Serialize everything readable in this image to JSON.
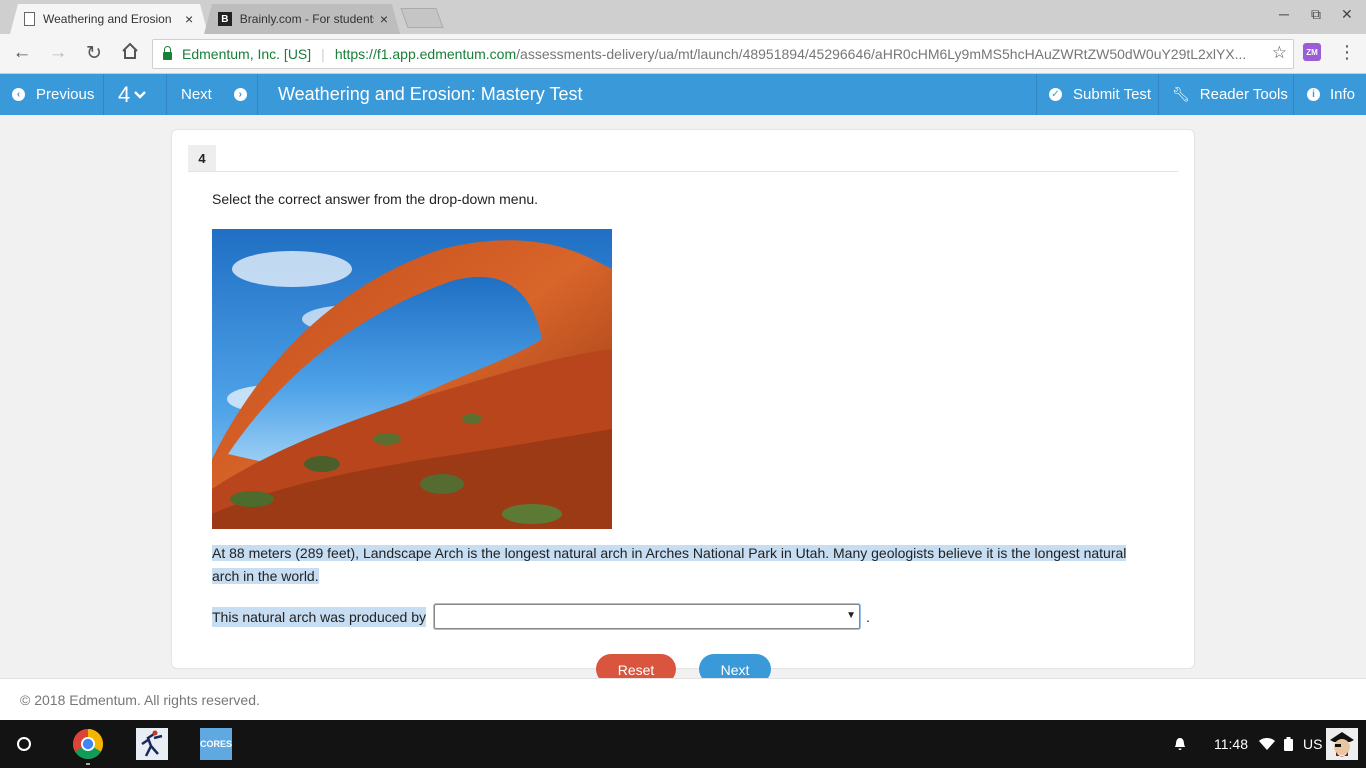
{
  "browser": {
    "tabs": [
      {
        "title": "Weathering and Erosion",
        "close": "×"
      },
      {
        "title": "Brainly.com - For students",
        "close": "×",
        "favicon": "B"
      }
    ],
    "window_controls": {
      "minimize": "─",
      "restore": "⧉",
      "close": "✕"
    },
    "site_identity": "Edmentum, Inc. [US]",
    "url_host": "https://f1.app.edmentum.com",
    "url_path": "/assessments-delivery/ua/mt/launch/48951894/45296646/aHR0cHM6Ly9mMS5hcHAuZWRtZW50dW0uY29tL2xlYX...",
    "extension_label": "ZM"
  },
  "appbar": {
    "previous_label": "Previous",
    "question_selector": "4",
    "next_label": "Next",
    "title": "Weathering and Erosion: Mastery Test",
    "submit_label": "Submit Test",
    "reader_tools_label": "Reader Tools",
    "info_label": "Info",
    "color": "#3a9ad9"
  },
  "question": {
    "number": "4",
    "instruction": "Select the correct answer from the drop-down menu.",
    "passage": "At 88 meters (289 feet), Landscape Arch is the longest natural arch in Arches National Park in Utah. Many geologists believe it is the longest natural arch in the world.",
    "prompt": "This natural arch was produced by",
    "dropdown_value": "",
    "trailing": ".",
    "reset_label": "Reset",
    "next_label": "Next"
  },
  "footer": {
    "copyright": "© 2018 Edmentum. All rights reserved."
  },
  "shelf": {
    "time": "11:48",
    "locale": "US",
    "cores_label": "CORES"
  }
}
